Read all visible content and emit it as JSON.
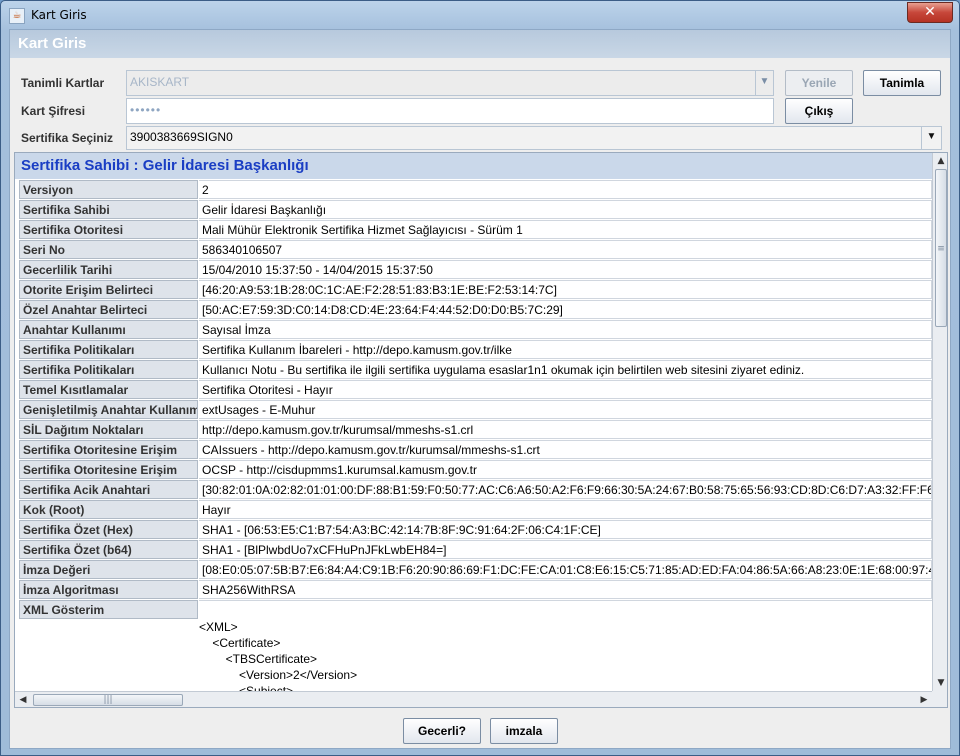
{
  "window": {
    "title": "Kart Giris",
    "close_glyph": "✕"
  },
  "header": {
    "title": "Kart Giris"
  },
  "form": {
    "card_label": "Tanimli Kartlar",
    "card_value": "AKISKART",
    "pin_label": "Kart Şifresi",
    "pin_value": "••••••",
    "cert_label": "Sertifika Seçiniz",
    "cert_value": "3900383669SIGN0"
  },
  "buttons": {
    "refresh": "Yenile",
    "define": "Tanimla",
    "exit": "Çıkış",
    "valid": "Gecerli?",
    "sign": "imzala"
  },
  "cert": {
    "heading": "Sertifika Sahibi : Gelir İdaresi Başkanlığı",
    "rows": [
      {
        "key": "Versiyon",
        "value": "2"
      },
      {
        "key": "Sertifika Sahibi",
        "value": "Gelir İdaresi Başkanlığı"
      },
      {
        "key": "Sertifika Otoritesi",
        "value": "Mali Mühür Elektronik Sertifika Hizmet Sağlayıcısı - Sürüm 1"
      },
      {
        "key": "Seri No",
        "value": "586340106507"
      },
      {
        "key": "Gecerlilik Tarihi",
        "value": "15/04/2010 15:37:50 - 14/04/2015 15:37:50"
      },
      {
        "key": "Otorite Erişim Belirteci",
        "value": "[46:20:A9:53:1B:28:0C:1C:AE:F2:28:51:83:B3:1E:BE:F2:53:14:7C]"
      },
      {
        "key": "Özel Anahtar Belirteci",
        "value": "[50:AC:E7:59:3D:C0:14:D8:CD:4E:23:64:F4:44:52:D0:D0:B5:7C:29]"
      },
      {
        "key": "Anahtar Kullanımı",
        "value": "Sayısal İmza"
      },
      {
        "key": "Sertifika Politikaları",
        "value": "Sertifika Kullanım İbareleri - http://depo.kamusm.gov.tr/ilke"
      },
      {
        "key": "Sertifika Politikaları",
        "value": "Kullanıcı Notu - Bu sertifika ile ilgili sertifika uygulama esaslar1n1 okumak için belirtilen web sitesini ziyaret ediniz."
      },
      {
        "key": "Temel Kısıtlamalar",
        "value": "Sertifika Otoritesi - Hayır"
      },
      {
        "key": "Genişletilmiş Anahtar Kullanımı",
        "value": "extUsages - E-Muhur"
      },
      {
        "key": "SİL Dağıtım Noktaları",
        "value": " http://depo.kamusm.gov.tr/kurumsal/mmeshs-s1.crl"
      },
      {
        "key": "Sertifika Otoritesine Erişim",
        "value": "CAIssuers - http://depo.kamusm.gov.tr/kurumsal/mmeshs-s1.crt"
      },
      {
        "key": "Sertifika Otoritesine Erişim",
        "value": "OCSP - http://cisdupmms1.kurumsal.kamusm.gov.tr"
      },
      {
        "key": "Sertifika Acik Anahtari",
        "value": "[30:82:01:0A:02:82:01:01:00:DF:88:B1:59:F0:50:77:AC:C6:A6:50:A2:F6:F9:66:30:5A:24:67:B0:58:75:65:56:93:CD:8D:C6:D7:A3:32:FF:F6"
      },
      {
        "key": "Kok (Root)",
        "value": "Hayır"
      },
      {
        "key": "Sertifika Özet (Hex)",
        "value": "SHA1 - [06:53:E5:C1:B7:54:A3:BC:42:14:7B:8F:9C:91:64:2F:06:C4:1F:CE]"
      },
      {
        "key": "Sertifika Özet (b64)",
        "value": "SHA1 - [BlPlwbdUo7xCFHuPnJFkLwbEH84=]"
      },
      {
        "key": "İmza Değeri",
        "value": "[08:E0:05:07:5B:B7:E6:84:A4:C9:1B:F6:20:90:86:69:F1:DC:FE:CA:01:C8:E6:15:C5:71:85:AD:ED:FA:04:86:5A:66:A8:23:0E:1E:68:00:97:4"
      },
      {
        "key": "İmza Algoritması",
        "value": "SHA256WithRSA"
      }
    ],
    "xml_key": "XML Gösterim",
    "xml_lines": [
      "<XML>",
      "    <Certificate>",
      "        <TBSCertificate>",
      "            <Version>2</Version>",
      "            <Subject>"
    ]
  },
  "icons": {
    "java": "java-cup-icon",
    "dropdown": "chevron-down-icon",
    "scroll_up": "arrow-up-icon",
    "scroll_down": "arrow-down-icon",
    "scroll_left": "arrow-left-icon",
    "scroll_right": "arrow-right-icon"
  }
}
